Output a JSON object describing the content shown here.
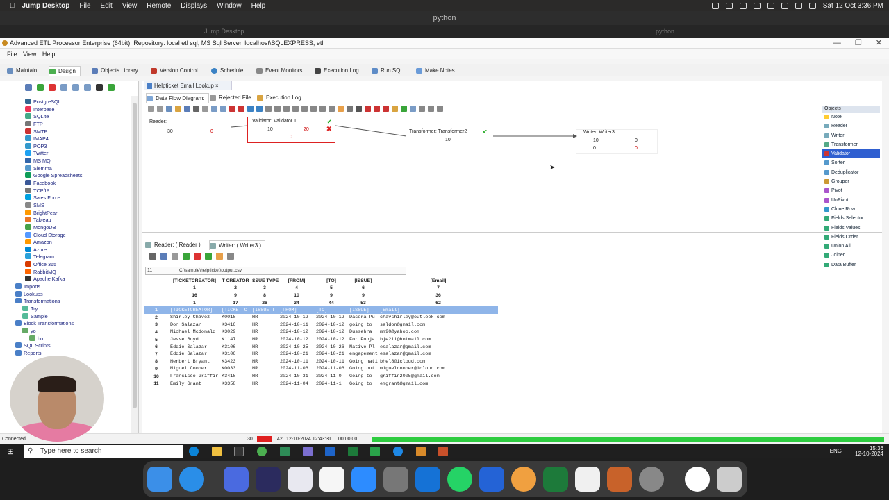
{
  "mac_menu": {
    "app": "Jump Desktop",
    "items": [
      "File",
      "Edit",
      "View",
      "Remote",
      "Displays",
      "Window",
      "Help"
    ],
    "clock": "Sat 12 Oct  3:36 PM"
  },
  "jd_window": {
    "title": "python",
    "tab_left": "Jump Desktop",
    "tab_right": "python"
  },
  "app": {
    "title": "Advanced ETL Processor Enterprise (64bit), Repository: local etl sql, MS Sql Server, localhost\\SQLEXPRESS, etl",
    "menu": [
      "File",
      "View",
      "Help"
    ],
    "main_tabs": [
      "Maintain",
      "Design",
      "Objects Library",
      "Version Control",
      "Schedule",
      "Event Monitors",
      "Execution Log",
      "Run SQL",
      "Make Notes"
    ],
    "tree": [
      "PostgreSQL",
      "Interbase",
      "SQLite",
      "FTP",
      "SMTP",
      "IMAP4",
      "POP3",
      "Twitter",
      "MS MQ",
      "Slemma",
      "Google Spreadsheets",
      "Facebook",
      "TCP/IP",
      "Sales Force",
      "SMS",
      "BrightPearl",
      "Tableau",
      "MongoDB",
      "Cloud Storage",
      "Amazon",
      "Azure",
      "Telegram",
      "Office 365",
      "RabbitMQ",
      "Apache Kafka",
      "Imports",
      "Lookups",
      "Transformations",
      "Try",
      "Sample",
      "Block Transformations",
      "yo",
      "ho",
      "SQL Scripts",
      "Reports"
    ],
    "doc_tab": "Helpticket Email Lookup",
    "sub_tabs": [
      "Data Flow Diagram:",
      "Rejected File",
      "Execution Log"
    ],
    "nodes": {
      "reader": {
        "title": "Reader:",
        "a": "30",
        "b": "0"
      },
      "validator": {
        "title": "Validator: Validator 1",
        "a": "10",
        "b": "20",
        "c": "0"
      },
      "transformer": {
        "title": "Transformer: Transformer2",
        "a": "10"
      },
      "writer": {
        "title": "Writer: Writer3",
        "a": "10",
        "b": "0",
        "c": "0",
        "d": "0"
      }
    },
    "objects_header": "Objects",
    "objects": [
      "Note",
      "Reader",
      "Writer",
      "Transformer",
      "Validator",
      "Sorter",
      "Deduplicator",
      "Grouper",
      "Pivot",
      "UnPivot",
      "Clone Row",
      "Fields Selector",
      "Fields Values",
      "Fields Order",
      "Union All",
      "Joiner",
      "Data Buffer"
    ],
    "bottom_tabs": [
      "Reader: ( Reader )",
      "Writer: ( Writer3 )"
    ],
    "file_path": "C:\\sample\\helpticket\\output.csv",
    "record_no": "11",
    "grid": {
      "headers": [
        "[TICKETCREATOR]",
        "T CREATOR",
        "SSUE TYPE",
        "[FROM]",
        "[TO]",
        "[ISSUE]",
        "[Email]"
      ],
      "row_a": [
        "1",
        "2",
        "3",
        "4",
        "5",
        "6",
        "7"
      ],
      "row_b": [
        "16",
        "9",
        "8",
        "10",
        "9",
        "9",
        "36"
      ],
      "row_c": [
        "1",
        "17",
        "26",
        "34",
        "44",
        "53",
        "62"
      ],
      "rows": [
        [
          "1",
          "[TICKETCREATOR]",
          "[TICKET C",
          "[ISSUE T",
          "[FROM]",
          "[TO]",
          "[ISSUE]",
          "[Email]"
        ],
        [
          "2",
          "Shirley Chavez",
          "K0018",
          "HR",
          "2024-10-12",
          "2024-10-12",
          "Dasera Pu",
          "chavshirley@outlook.com"
        ],
        [
          "3",
          "Don Salazar",
          "K3416",
          "HR",
          "2024-10-11",
          "2024-10-12",
          "going to",
          "saldon@gmail.com"
        ],
        [
          "4",
          "Michael Mcdonald",
          "K3029",
          "HR",
          "2024-10-12",
          "2024-10-12",
          "Dussehra",
          "mm90@yahoo.com"
        ],
        [
          "5",
          "Jesse Boyd",
          "K1147",
          "HR",
          "2024-10-12",
          "2024-10-12",
          "For Pooja",
          "bje211@hotmail.com"
        ],
        [
          "6",
          "Eddie Salazar",
          "K3106",
          "HR",
          "2024-10-25",
          "2024-10-26",
          "Native Pl",
          "esalazar@gmail.com"
        ],
        [
          "7",
          "Eddie Salazar",
          "K3106",
          "HR",
          "2024-10-21",
          "2024-10-21",
          "engagement",
          "esalazar@gmail.com"
        ],
        [
          "8",
          "Herbert Bryant",
          "K3423",
          "HR",
          "2024-10-11",
          "2024-10-11",
          "Going nati",
          "bhel8@icloud.com"
        ],
        [
          "9",
          "Miguel Cooper",
          "K0033",
          "HR",
          "2024-11-06",
          "2024-11-06",
          "Going out",
          "miguelcooper@icloud.com"
        ],
        [
          "10",
          "Francisco Griffir",
          "K3418",
          "HR",
          "2024-10-31",
          "2024-11-0",
          "Going to",
          "griffin2005@gmail.com"
        ],
        [
          "11",
          "Emily Grant",
          "K3358",
          "HR",
          "2024-11-04",
          "2024-11-1",
          "Going to",
          "emgrant@gmail.com"
        ]
      ]
    },
    "status": {
      "connected": "Connected",
      "count1": "30",
      "count2": "42",
      "datetime": "12-10-2024 12:43:31",
      "elapsed": "00:00:00",
      "progress": 1.0
    }
  },
  "taskbar": {
    "search_placeholder": "Type here to search",
    "lang": "ENG",
    "time": "15:36",
    "date": "12-10-2024"
  }
}
